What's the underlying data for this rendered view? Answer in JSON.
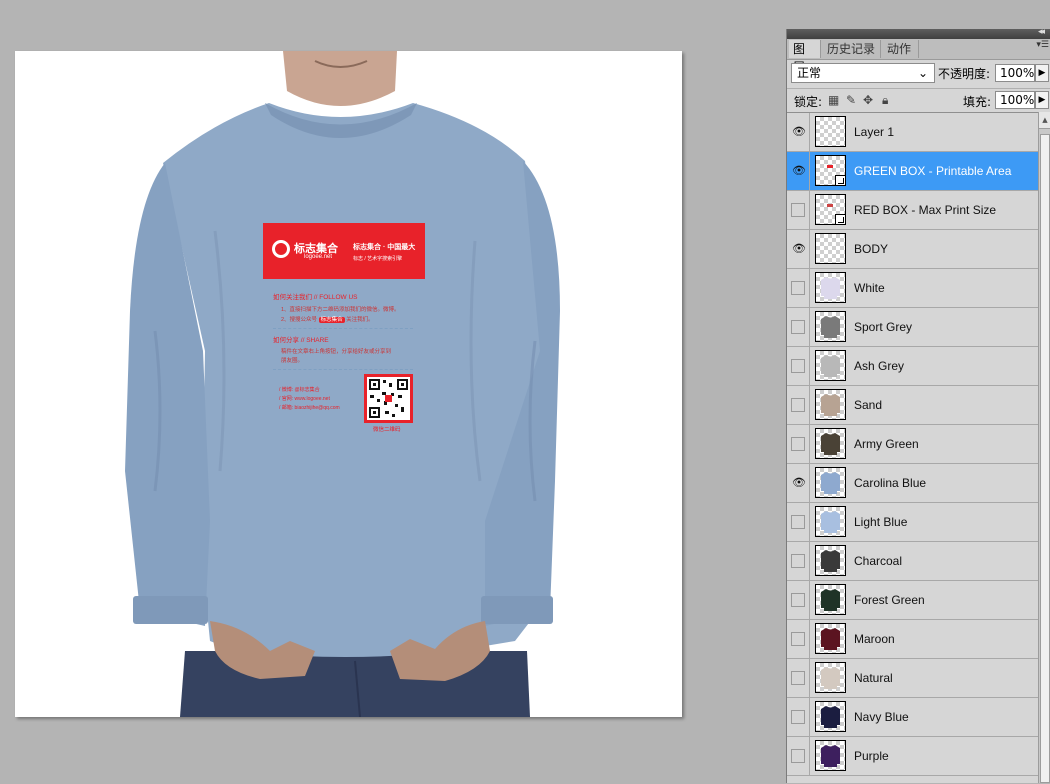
{
  "panel": {
    "tabs": [
      {
        "label": "图层",
        "active": true
      },
      {
        "label": "历史记录",
        "active": false
      },
      {
        "label": "动作",
        "active": false
      }
    ],
    "collapse_icon": "double-chevron-left-icon",
    "menu_icon": "panel-menu-icon",
    "blend_mode": "正常",
    "opacity_label": "不透明度:",
    "opacity_value": "100%",
    "lock_label": "锁定:",
    "fill_label": "填充:",
    "fill_value": "100%"
  },
  "layers": [
    {
      "name": "Layer 1",
      "visible": true,
      "selected": false,
      "color": null,
      "smart": false
    },
    {
      "name": "GREEN BOX - Printable Area",
      "visible": true,
      "selected": true,
      "color": null,
      "smart": true
    },
    {
      "name": "RED BOX - Max Print Size",
      "visible": false,
      "selected": false,
      "color": null,
      "smart": true
    },
    {
      "name": "BODY",
      "visible": true,
      "selected": false,
      "color": null,
      "smart": false
    },
    {
      "name": "White",
      "visible": false,
      "selected": false,
      "color": "#dcd8ec",
      "smart": false
    },
    {
      "name": "Sport Grey",
      "visible": false,
      "selected": false,
      "color": "#7a7a7a",
      "smart": false
    },
    {
      "name": "Ash Grey",
      "visible": false,
      "selected": false,
      "color": "#b8b8b8",
      "smart": false
    },
    {
      "name": "Sand",
      "visible": false,
      "selected": false,
      "color": "#b7a393",
      "smart": false
    },
    {
      "name": "Army Green",
      "visible": false,
      "selected": false,
      "color": "#4a4236",
      "smart": false
    },
    {
      "name": "Carolina Blue",
      "visible": true,
      "selected": false,
      "color": "#8ea9cf",
      "smart": false
    },
    {
      "name": "Light Blue",
      "visible": false,
      "selected": false,
      "color": "#a8bfe0",
      "smart": false
    },
    {
      "name": "Charcoal",
      "visible": false,
      "selected": false,
      "color": "#3a3a3a",
      "smart": false
    },
    {
      "name": "Forest Green",
      "visible": false,
      "selected": false,
      "color": "#1f3327",
      "smart": false
    },
    {
      "name": "Maroon",
      "visible": false,
      "selected": false,
      "color": "#5b1420",
      "smart": false
    },
    {
      "name": "Natural",
      "visible": false,
      "selected": false,
      "color": "#d3c9c0",
      "smart": false
    },
    {
      "name": "Navy Blue",
      "visible": false,
      "selected": false,
      "color": "#1b1d40",
      "smart": false
    },
    {
      "name": "Purple",
      "visible": false,
      "selected": false,
      "color": "#3d1f5e",
      "smart": false
    }
  ],
  "print": {
    "logo_cn": "标志集合",
    "logo_url": "logoee.net",
    "slogan": "标志集合 · 中国最大",
    "slogan2": "标志 / 艺术字搜索引擎",
    "follow_title": "如何关注我们 // FOLLOW US",
    "follow_1": "1、直接扫描下方二维码添加我们的微信。微博。",
    "follow_2_pre": "2、搜搜公众号",
    "follow_2_badge": "标志集合",
    "follow_2_post": "关注我们。",
    "share_title": "如何分享 // SHARE",
    "share_1": "稿件在文章右上角按钮，分享给好友或分享到",
    "share_2": "朋友圈。",
    "contact_1": "/ 微博: @标志集合",
    "contact_2": "/ 官网: www.logoee.net",
    "contact_3": "/ 邮箱: biaozhijihe@qq.com",
    "qr_caption": "微信二维码"
  },
  "colors": {
    "shirt": "#8fa9c7",
    "accent": "#e8222a",
    "selection": "#3d9af5"
  }
}
